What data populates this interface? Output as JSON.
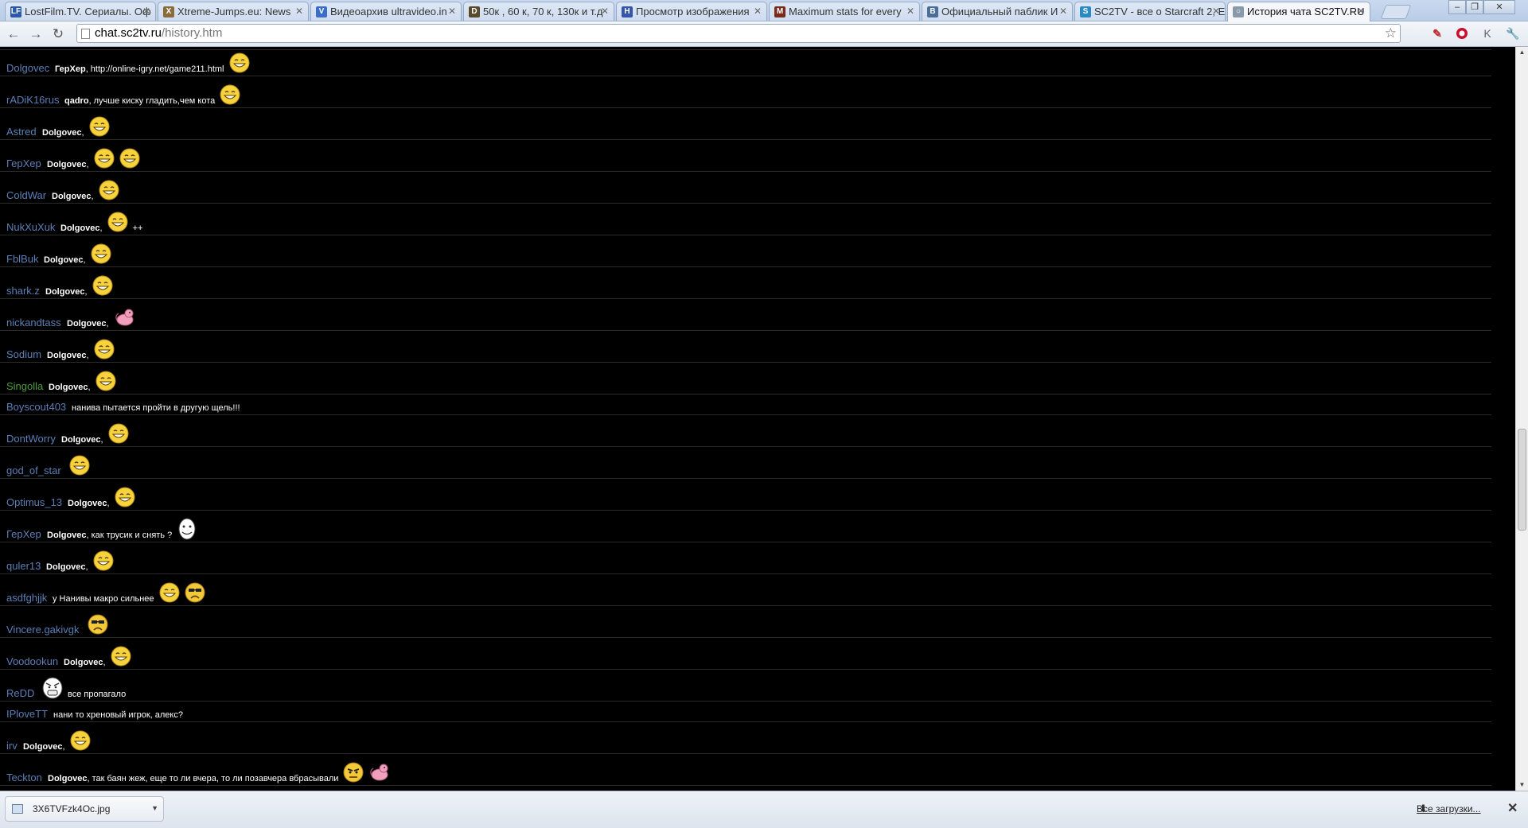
{
  "browser": {
    "tabs": [
      {
        "label": "LostFilm.TV. Сериалы. Оф",
        "favicon": "LF",
        "color": "#2b5aa8"
      },
      {
        "label": "Xtreme-Jumps.eu: News",
        "favicon": "X",
        "color": "#8a6b3a"
      },
      {
        "label": "Видеоархив ultravideo.in",
        "favicon": "V",
        "color": "#3b6fc7"
      },
      {
        "label": "50к , 60 к, 70 к, 130к и т.д",
        "favicon": "D",
        "color": "#5a4a2a"
      },
      {
        "label": "Просмотр изображения",
        "favicon": "H",
        "color": "#3355aa"
      },
      {
        "label": "Maximum stats for every",
        "favicon": "M",
        "color": "#7a2a1a"
      },
      {
        "label": "Официальный паблик И",
        "favicon": "B",
        "color": "#4a6e9a"
      },
      {
        "label": "SC2TV - все о Starcraft 2, E",
        "favicon": "S",
        "color": "#2c8ac2"
      },
      {
        "label": "История чата SC2TV.RU",
        "favicon": "○",
        "color": "#8899aa"
      }
    ],
    "url_host": "chat.sc2tv.ru",
    "url_path": "/history.htm"
  },
  "chat": {
    "messages": [
      {
        "nick": "Dolgovec",
        "to": "ГерХер",
        "text": "http://online-igry.net/game211.html",
        "emotes_after": [
          "smile"
        ],
        "text_after": "",
        "h": 33
      },
      {
        "nick": "rADiK16rus",
        "to": "qadro",
        "text": "лучше киску гладить,чем кота",
        "emotes_after": [
          "smile"
        ],
        "text_after": "",
        "h": 33
      },
      {
        "nick": "Astred",
        "to": "Dolgovec",
        "text": "",
        "emotes_after": [
          "smile"
        ],
        "text_after": "",
        "h": 33
      },
      {
        "nick": "ГерХер",
        "to": "Dolgovec",
        "text": "",
        "emotes_after": [
          "smile",
          "smile"
        ],
        "text_after": "",
        "h": 33
      },
      {
        "nick": "ColdWar",
        "to": "Dolgovec",
        "text": "",
        "emotes_after": [
          "smile"
        ],
        "text_after": "",
        "h": 33
      },
      {
        "nick": "NukXuXuk",
        "to": "Dolgovec",
        "text": "",
        "emotes_after": [
          "smile"
        ],
        "text_after": "++",
        "h": 33
      },
      {
        "nick": "FblBuk",
        "to": "Dolgovec",
        "text": "",
        "emotes_after": [
          "smile"
        ],
        "text_after": "",
        "h": 33
      },
      {
        "nick": "shark.z",
        "to": "Dolgovec",
        "text": "",
        "emotes_after": [
          "smile"
        ],
        "text_after": "",
        "h": 33
      },
      {
        "nick": "nickandtass",
        "to": "Dolgovec",
        "text": "",
        "emotes_after": [
          "pink"
        ],
        "text_after": "",
        "h": 33
      },
      {
        "nick": "Sodium",
        "to": "Dolgovec",
        "text": "",
        "emotes_after": [
          "smile"
        ],
        "text_after": "",
        "h": 33
      },
      {
        "nick": "Singolla",
        "to": "Dolgovec",
        "text": "",
        "emotes_after": [
          "smile"
        ],
        "text_after": "",
        "h": 33,
        "green": true
      },
      {
        "nick": "Boyscout403",
        "to": "",
        "text": "нанива пытается пройти в другую щель!!!",
        "emotes_after": [],
        "text_after": "",
        "h": 19
      },
      {
        "nick": "DontWorry",
        "to": "Dolgovec",
        "text": "",
        "emotes_after": [
          "smile"
        ],
        "text_after": "",
        "h": 33
      },
      {
        "nick": "god_of_star",
        "to": "",
        "text": "",
        "emotes_after": [
          "smile"
        ],
        "text_after": "",
        "h": 33
      },
      {
        "nick": "Optimus_13",
        "to": "Dolgovec",
        "text": "",
        "emotes_after": [
          "smile"
        ],
        "text_after": "",
        "h": 33
      },
      {
        "nick": "ГерХер",
        "to": "Dolgovec",
        "text": "как трусик и снять ?",
        "emotes_after": [
          "troll"
        ],
        "text_after": "",
        "h": 33
      },
      {
        "nick": "quler13",
        "to": "Dolgovec",
        "text": "",
        "emotes_after": [
          "smile"
        ],
        "text_after": "",
        "h": 33
      },
      {
        "nick": "asdfghjjk",
        "to": "",
        "text": "у Нанивы макро сильнее",
        "emotes_after": [
          "smile",
          "angry"
        ],
        "text_after": "",
        "h": 33
      },
      {
        "nick": "Vincere.gakivgk",
        "to": "",
        "text": "",
        "emotes_after": [
          "angry"
        ],
        "text_after": "",
        "h": 33
      },
      {
        "nick": "Voodookun",
        "to": "Dolgovec",
        "text": "",
        "emotes_after": [
          "smile"
        ],
        "text_after": "",
        "h": 33
      },
      {
        "nick": "ReDD",
        "to": "",
        "text": "",
        "emotes_after": [
          "rage"
        ],
        "text_after": "все пропагало",
        "h": 33
      },
      {
        "nick": "IPloveTT",
        "to": "",
        "text": "нани то хреновый игрок, алекс?",
        "emotes_after": [],
        "text_after": "",
        "h": 19
      },
      {
        "nick": "irv",
        "to": "Dolgovec",
        "text": "",
        "emotes_after": [
          "smile"
        ],
        "text_after": "",
        "h": 33
      },
      {
        "nick": "Teckton",
        "to": "Dolgovec",
        "text": "так баян жеж, еще то ли вчера, то ли позавчера вбрасывали",
        "emotes_after": [
          "meh",
          "pink"
        ],
        "text_after": "",
        "h": 33
      }
    ]
  },
  "downloads": {
    "file": "3X6TVFzk4Oc.jpg",
    "all_label": "Все загрузки..."
  }
}
